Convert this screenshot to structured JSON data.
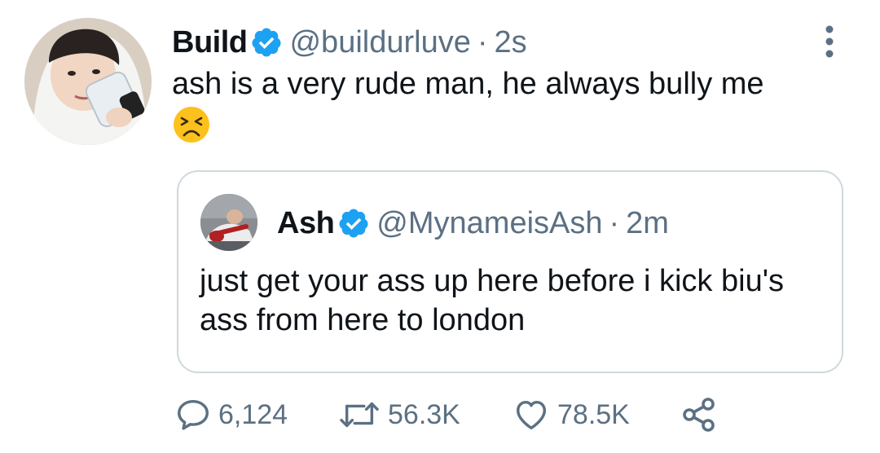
{
  "tweet": {
    "author": "Build",
    "handle": "@buildurluve",
    "separator": "·",
    "time": "2s",
    "text": "ash is a very rude man, he always bully me",
    "emoji": "tired-face-emoji"
  },
  "quote": {
    "author": "Ash",
    "handle": "@MynameisAsh",
    "separator": "·",
    "time": "2m",
    "text": "just get your ass up here before i kick biu's ass from here to london"
  },
  "actions": {
    "replies": "6,124",
    "retweets": "56.3K",
    "likes": "78.5K"
  },
  "icons": {
    "verified": "verified-badge-icon",
    "more": "more-options-icon",
    "reply": "reply-icon",
    "retweet": "retweet-icon",
    "like": "heart-icon",
    "share": "share-icon"
  },
  "colors": {
    "verified_blue": "#1da1f2",
    "secondary_text": "#5b7083",
    "border": "#cfd9de"
  }
}
